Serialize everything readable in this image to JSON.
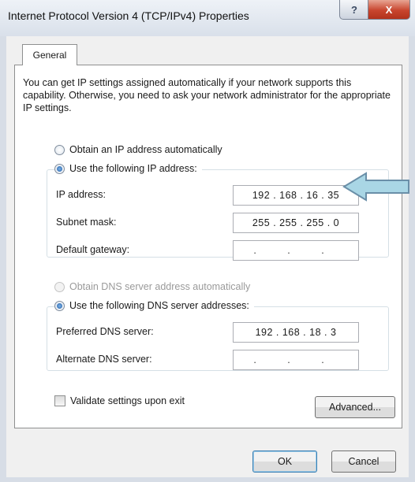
{
  "window": {
    "title": "Internet Protocol Version 4 (TCP/IPv4) Properties",
    "help_label": "?",
    "close_label": "X"
  },
  "tabs": [
    {
      "label": "General"
    }
  ],
  "intro_text": "You can get IP settings assigned automatically if your network supports this capability. Otherwise, you need to ask your network administrator for the appropriate IP settings.",
  "ip_section": {
    "auto_label": "Obtain an IP address automatically",
    "manual_label": "Use the following IP address:",
    "selected": "manual",
    "fields": [
      {
        "label": "IP address:",
        "value": "192 . 168 . 16 . 35"
      },
      {
        "label": "Subnet mask:",
        "value": "255 . 255 . 255 . 0"
      },
      {
        "label": "Default gateway:",
        "value": ". . ."
      }
    ]
  },
  "dns_section": {
    "auto_label": "Obtain DNS server address automatically",
    "manual_label": "Use the following DNS server addresses:",
    "selected": "manual",
    "fields": [
      {
        "label": "Preferred DNS server:",
        "value": "192 . 168 . 18 . 3"
      },
      {
        "label": "Alternate DNS server:",
        "value": ". . ."
      }
    ]
  },
  "validate_label": "Validate settings upon exit",
  "advanced_label": "Advanced...",
  "ok_label": "OK",
  "cancel_label": "Cancel",
  "annotation": {
    "icon": "left-arrow-icon",
    "color": "#a9d6e5",
    "stroke": "#6a8fa8"
  }
}
